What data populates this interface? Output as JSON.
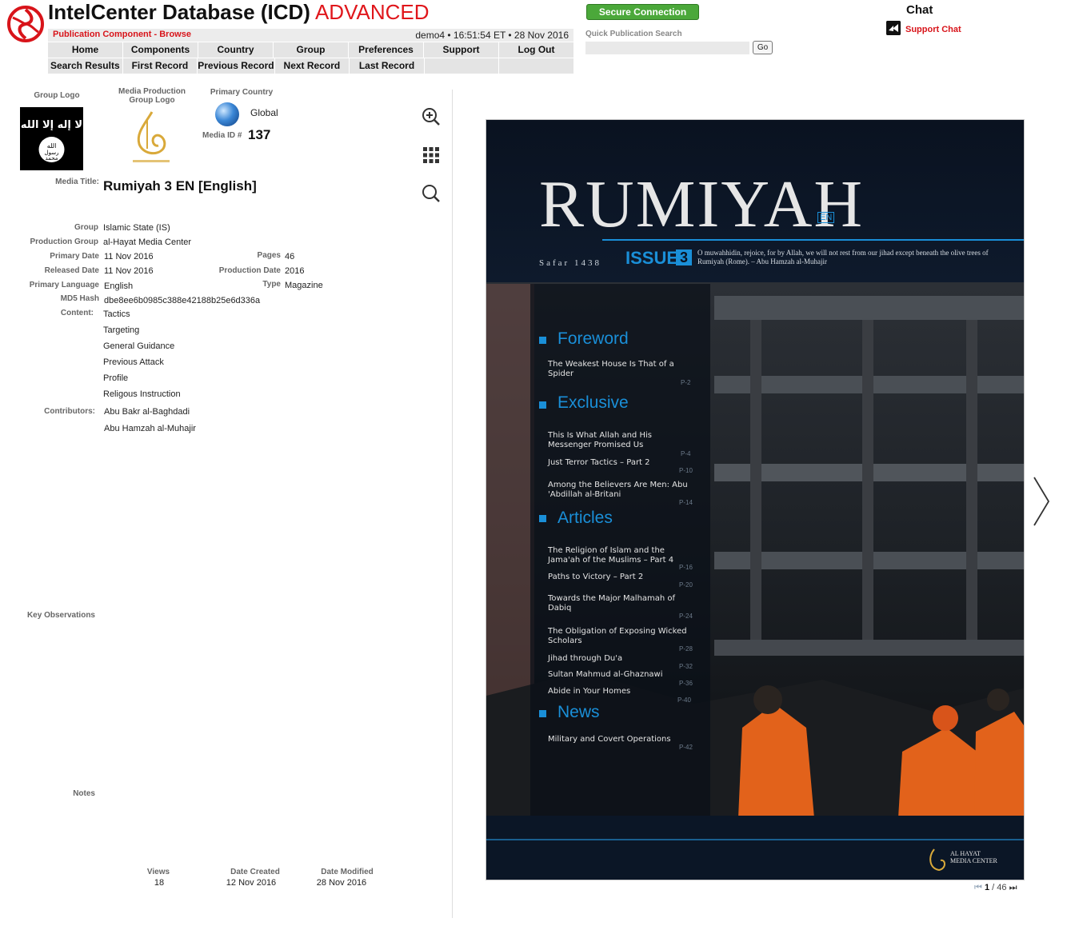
{
  "app": {
    "title": "IntelCenter Database (ICD)",
    "edition": "ADVANCED",
    "crumb": "Publication Component - Browse",
    "session_info": "demo4 • 16:51:54 ET • 28 Nov 2016"
  },
  "nav": {
    "row1": [
      "Home",
      "Components",
      "Country",
      "Group",
      "Preferences",
      "Support",
      "Log Out"
    ],
    "row2": [
      "Search Results",
      "First Record",
      "Previous Record",
      "Next Record",
      "Last Record",
      "",
      ""
    ]
  },
  "secure_connection": "Secure Connection",
  "quick_search": {
    "label": "Quick Publication Search",
    "value": "",
    "go": "Go"
  },
  "chat": {
    "title": "Chat",
    "support": "Support Chat"
  },
  "record": {
    "group_logo_label": "Group Logo",
    "media_production_label": "Media Production Group Logo",
    "primary_country_label": "Primary Country",
    "primary_country": "Global",
    "media_id_label": "Media ID #",
    "media_id": "137",
    "media_title_label": "Media Title:",
    "media_title": "Rumiyah 3 EN [English]",
    "fields": {
      "group_label": "Group",
      "group": "Islamic State (IS)",
      "production_group_label": "Production Group",
      "production_group": "al-Hayat Media Center",
      "primary_date_label": "Primary Date",
      "primary_date": "11 Nov 2016",
      "released_date_label": "Released Date",
      "released_date": "11 Nov 2016",
      "primary_language_label": "Primary Language",
      "primary_language": "English",
      "md5_label": "MD5 Hash",
      "md5": "dbe8ee6b0985c388e42188b25e6d336a",
      "pages_label": "Pages",
      "pages": "46",
      "production_date_label": "Production Date",
      "production_date": "2016",
      "type_label": "Type",
      "type": "Magazine"
    },
    "content_label": "Content:",
    "content": [
      "Tactics",
      "Targeting",
      "General Guidance",
      "Previous Attack",
      "Profile",
      "Religous Instruction"
    ],
    "contributors_label": "Contributors:",
    "contributors": [
      "Abu Bakr al-Baghdadi",
      "Abu Hamzah al-Muhajir"
    ],
    "key_observations_label": "Key Observations",
    "notes_label": "Notes",
    "views_label": "Views",
    "views": "18",
    "date_created_label": "Date Created",
    "date_created": "12 Nov 2016",
    "date_modified_label": "Date Modified",
    "date_modified": "28 Nov 2016"
  },
  "tools": [
    "zoom-in-icon",
    "grid-icon",
    "search-icon"
  ],
  "viewer": {
    "current_page": "1",
    "total_pages": "/ 46",
    "cover": {
      "masthead": "RUMIYAH",
      "lang_badge": "EN",
      "issue_label": "ISSUE",
      "issue_number": "3",
      "date_line": "Safar 1438",
      "quote": "O muwahhidin, rejoice, for by Allah, we will not rest from our jihad except beneath the olive trees of Rumiyah (Rome). – Abu Hamzah al-Muhajir",
      "sections": [
        {
          "heading": "Foreword",
          "items": [
            {
              "title": "The Weakest House Is That of a Spider",
              "page": "P-2"
            }
          ]
        },
        {
          "heading": "Exclusive",
          "items": [
            {
              "title": "This Is What Allah and His Messenger Promised Us",
              "page": "P-4"
            },
            {
              "title": "Just Terror Tactics – Part 2",
              "page": "P-10"
            },
            {
              "title": "Among the Believers Are Men: Abu 'Abdillah al-Britani",
              "page": "P-14"
            }
          ]
        },
        {
          "heading": "Articles",
          "items": [
            {
              "title": "The Religion of Islam and the Jama'ah of the Muslims – Part 4",
              "page": "P-16"
            },
            {
              "title": "Paths to Victory – Part 2",
              "page": "P-20"
            },
            {
              "title": "Towards the Major Malhamah of Dabiq",
              "page": "P-24"
            },
            {
              "title": "The Obligation of Exposing Wicked Scholars",
              "page": "P-28"
            },
            {
              "title": "Jihad through Du'a",
              "page": "P-32"
            },
            {
              "title": "Sultan Mahmud al-Ghaznawi",
              "page": "P-36"
            },
            {
              "title": "Abide in Your Homes",
              "page": "P-40"
            }
          ]
        },
        {
          "heading": "News",
          "items": [
            {
              "title": "Military and Covert Operations",
              "page": "P-42"
            }
          ]
        }
      ],
      "publisher": "AL HAYAT MEDIA CENTER"
    }
  },
  "colors": {
    "brand_red": "#d8141a",
    "secure_green": "#4ba83a",
    "cover_blue": "#1a8fd8"
  }
}
